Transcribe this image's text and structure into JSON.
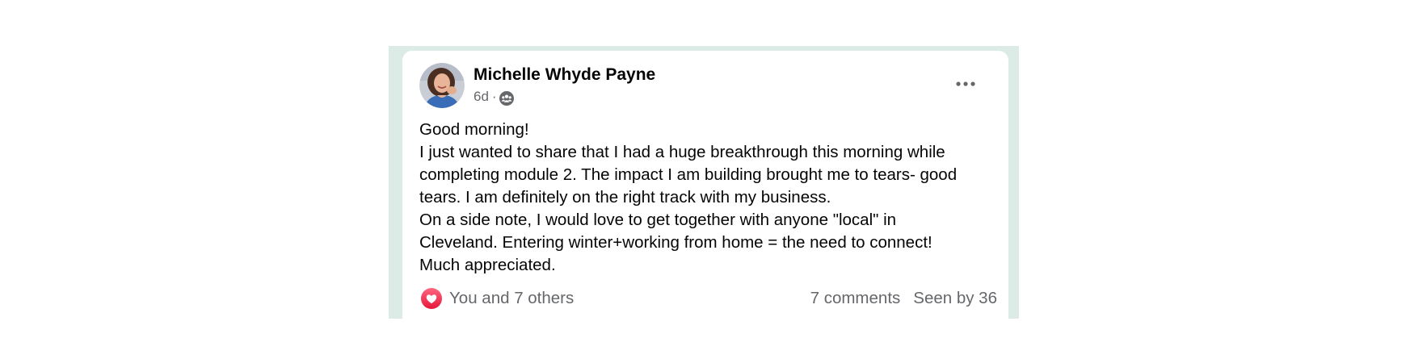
{
  "post": {
    "author": {
      "name": "Michelle Whyde Payne",
      "avatar_icon": "avatar-photo"
    },
    "time": "6d",
    "separator": "·",
    "audience_icon": "group-icon",
    "body_lines": [
      "Good morning!",
      "I just wanted to share that I had a huge breakthrough this morning while",
      "completing module 2. The impact I am building brought me to tears- good",
      "tears. I am definitely on the right track with my business.",
      "On a side note, I would love to get together with anyone \"local\" in",
      "Cleveland. Entering winter+working from home = the need to connect!",
      "Much appreciated."
    ],
    "reaction_icon": "heart-icon",
    "reactions_text": "You and 7 others",
    "comments_text": "7 comments",
    "seen_text": "Seen by 36"
  },
  "colors": {
    "frame_bg": "#dcebe6",
    "card_bg": "#ffffff",
    "text_primary": "#050505",
    "text_secondary": "#65676b",
    "heart": "#f33e58"
  }
}
